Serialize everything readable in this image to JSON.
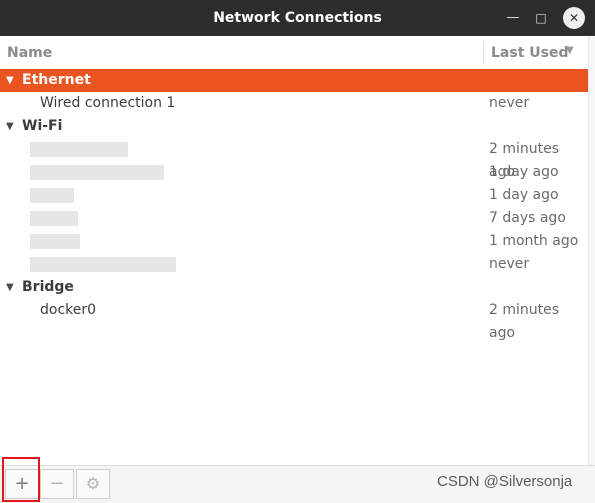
{
  "window": {
    "title": "Network Connections",
    "minimize_icon": "—",
    "maximize_icon": "□",
    "close_icon": "✕"
  },
  "columns": {
    "name": "Name",
    "last_used": "Last Used",
    "sort_icon": "▼"
  },
  "groups": [
    {
      "label": "Ethernet",
      "arrow": "▼",
      "selected": true,
      "items": [
        {
          "name": "Wired connection 1",
          "last_used": "never"
        }
      ]
    },
    {
      "label": "Wi-Fi",
      "arrow": "▼",
      "selected": false,
      "items": [
        {
          "name": "",
          "last_used": "2 minutes ago"
        },
        {
          "name": "",
          "last_used": "1 day ago"
        },
        {
          "name": "",
          "last_used": "1 day ago"
        },
        {
          "name": "",
          "last_used": "7 days ago"
        },
        {
          "name": "",
          "last_used": "1 month ago"
        },
        {
          "name": "",
          "last_used": "never"
        }
      ]
    },
    {
      "label": "Bridge",
      "arrow": "▼",
      "selected": false,
      "items": [
        {
          "name": "docker0",
          "last_used": "2 minutes ago"
        }
      ]
    }
  ],
  "toolbar": {
    "add_icon": "+",
    "remove_icon": "−",
    "settings_icon": "⚙"
  },
  "watermark": "CSDN @Silversonja",
  "colors": {
    "accent": "#e95420",
    "titlebar": "#2d2d2d",
    "highlight": "#e0161c"
  }
}
